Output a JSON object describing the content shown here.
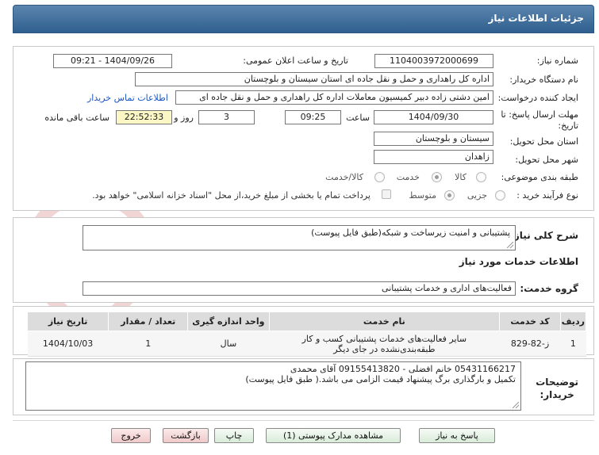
{
  "header": {
    "title": "جزئیات اطلاعات نیاز"
  },
  "watermark": {
    "text": "AriaTender.net",
    "color": "#f3dede"
  },
  "form": {
    "need_number_label": "شماره نیاز:",
    "need_number": "1104003972000699",
    "announce_label": "تاریخ و ساعت اعلان عمومی:",
    "announce_value": "1404/09/26 - 09:21",
    "buyer_org_label": "نام دستگاه خریدار:",
    "buyer_org": "اداره کل راهداری و حمل و نقل جاده ای استان سیستان و بلوچستان",
    "requester_label": "ایجاد کننده درخواست:",
    "requester": "امین دشتی زاده دبیر کمیسیون معاملات اداره کل راهداری و حمل و نقل جاده ای",
    "contact_link": "اطلاعات تماس خریدار",
    "deadline_label": "مهلت ارسال پاسخ: تا تاریخ:",
    "deadline_date": "1404/09/30",
    "time_label": "ساعت",
    "deadline_time": "09:25",
    "days_value": "3",
    "days_label": "روز و",
    "remaining_time": "22:52:33",
    "remaining_label": "ساعت باقی مانده",
    "province_label": "استان محل تحویل:",
    "province": "سیستان و بلوچستان",
    "city_label": "شهر محل تحویل:",
    "city": "زاهدان",
    "category_label": "طبقه بندی موضوعی:",
    "category_options": [
      "کالا",
      "خدمت",
      "کالا/خدمت"
    ],
    "category_selected": "خدمت",
    "process_label": "نوع فرآیند خرید :",
    "process_options": [
      "جزیی",
      "متوسط"
    ],
    "process_selected": "متوسط",
    "payment_note": "پرداخت تمام یا بخشی از مبلغ خرید،از محل \"اسناد خزانه اسلامی\" خواهد بود."
  },
  "summary": {
    "label": "شرح کلی نیاز:",
    "text": "پشتیبانی و امنیت زیرساخت و شبکه(طبق فایل پیوست)"
  },
  "services": {
    "section_title": "اطلاعات خدمات مورد نیاز",
    "group_label": "گروه خدمت:",
    "group_value": "فعالیت‌های اداری و خدمات پشتیبانی",
    "columns": [
      "ردیف",
      "کد خدمت",
      "نام خدمت",
      "واحد اندازه گیری",
      "تعداد / مقدار",
      "تاریخ نیاز"
    ],
    "rows": [
      {
        "row": "1",
        "code": "ز-82-829",
        "name_line1": "سایر فعالیت‌های خدمات پشتیبانی کسب و کار",
        "name_line2": "طبقه‌بندی‌نشده در جای دیگر",
        "unit": "سال",
        "qty": "1",
        "date": "1404/10/03"
      }
    ]
  },
  "buyer_notes": {
    "label_line1": "توضیحات",
    "label_line2": "خریدار:",
    "line1": "05431166217 خانم افضلی  -  09155413820  آقای محمدی",
    "line2": "تکمیل و بارگذاری برگ پیشنهاد قیمت الزامی می باشد.( طبق فایل پیوست)"
  },
  "buttons": {
    "respond": "پاسخ به نیاز",
    "view_docs": "مشاهده مدارک پیوستی (1)",
    "print": "چاپ",
    "back": "بازگشت",
    "exit": "خروج"
  }
}
